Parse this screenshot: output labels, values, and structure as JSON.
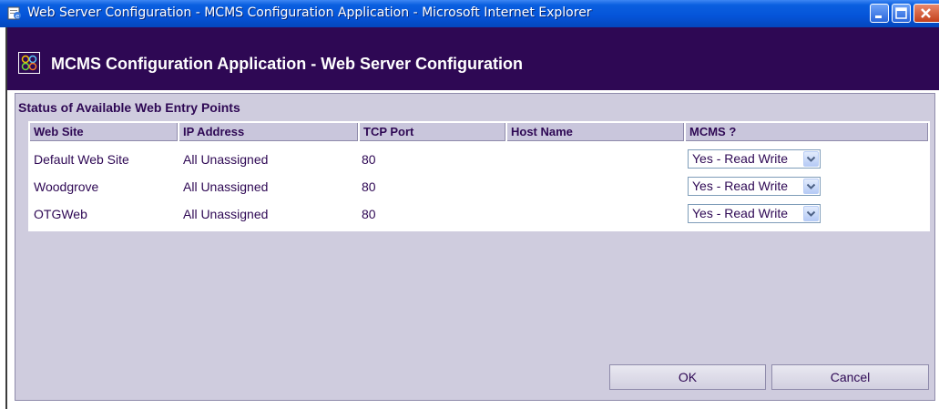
{
  "window": {
    "title": "Web Server Configuration - MCMS Configuration Application - Microsoft Internet Explorer",
    "icon": "ie-page-icon",
    "controls": [
      "minimize-icon",
      "maximize-icon",
      "close-icon"
    ]
  },
  "app": {
    "header": "MCMS Configuration Application - Web Server Configuration",
    "logo_icon": "mcms-logo-icon",
    "colors": {
      "header_bg": "#2e0854",
      "panel_bg": "#cfccde",
      "text": "#2e0854"
    }
  },
  "section": {
    "title": "Status of Available Web Entry Points"
  },
  "table": {
    "columns": [
      "Web Site",
      "IP Address",
      "TCP Port",
      "Host Name",
      "MCMS ?"
    ],
    "rows": [
      {
        "site": "Default Web Site",
        "ip": "All Unassigned",
        "port": "80",
        "host": "",
        "mcms": "Yes - Read Write"
      },
      {
        "site": "Woodgrove",
        "ip": "All Unassigned",
        "port": "80",
        "host": "",
        "mcms": "Yes - Read Write"
      },
      {
        "site": "OTGWeb",
        "ip": "All Unassigned",
        "port": "80",
        "host": "",
        "mcms": "Yes - Read Write"
      }
    ]
  },
  "buttons": {
    "ok": "OK",
    "cancel": "Cancel"
  }
}
